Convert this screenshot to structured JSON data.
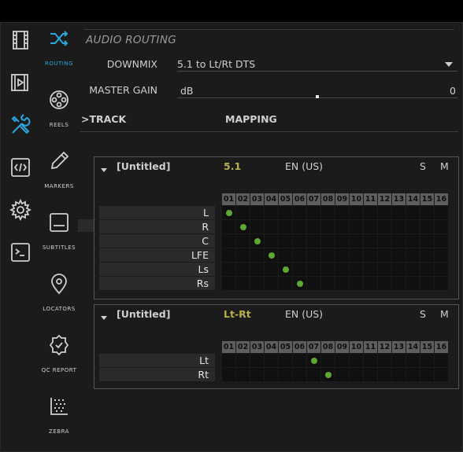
{
  "colors": {
    "accent": "#2aa6e0",
    "format": "#b9b04a",
    "mapped": "#5fa832"
  },
  "iconbar": [
    {
      "name": "film-icon"
    },
    {
      "name": "film-edit-icon"
    },
    {
      "name": "tools-icon",
      "active": true
    },
    {
      "name": "code-icon"
    },
    {
      "name": "gear-icon"
    },
    {
      "name": "terminal-icon"
    }
  ],
  "nav": [
    {
      "label": "ROUTING",
      "icon": "shuffle-icon",
      "active": true
    },
    {
      "label": "REELS",
      "icon": "reel-icon"
    },
    {
      "label": "MARKERS",
      "icon": "pen-icon"
    },
    {
      "label": "SUBTITLES",
      "icon": "subtitles-icon"
    },
    {
      "label": "LOCATORS",
      "icon": "location-icon"
    },
    {
      "label": "QC REPORT",
      "icon": "badge-check-icon"
    },
    {
      "label": "ZEBRA",
      "icon": "zebra-icon"
    }
  ],
  "panel": {
    "title": "AUDIO ROUTING",
    "downmix_label": "DOWNMIX",
    "downmix_value": "5.1 to Lt/Rt DTS",
    "gain_label": "MASTER GAIN",
    "gain_unit": "dB",
    "gain_value": "0",
    "gain_level": 0.5,
    "track_header": ">TRACK",
    "mapping_header": "MAPPING"
  },
  "columns": [
    "01",
    "02",
    "03",
    "04",
    "05",
    "06",
    "07",
    "08",
    "09",
    "10",
    "11",
    "12",
    "13",
    "14",
    "15",
    "16"
  ],
  "tracks": [
    {
      "name": "[Untitled]",
      "format": "5.1",
      "language": "EN (US)",
      "solo": "S",
      "mute": "M",
      "channels": [
        {
          "label": "L",
          "map": 1
        },
        {
          "label": "R",
          "map": 2
        },
        {
          "label": "C",
          "map": 3
        },
        {
          "label": "LFE",
          "map": 4
        },
        {
          "label": "Ls",
          "map": 5
        },
        {
          "label": "Rs",
          "map": 6
        }
      ]
    },
    {
      "name": "[Untitled]",
      "format": "Lt-Rt",
      "language": "EN (US)",
      "solo": "S",
      "mute": "M",
      "channels": [
        {
          "label": "Lt",
          "map": 7
        },
        {
          "label": "Rt",
          "map": 8
        }
      ]
    }
  ]
}
